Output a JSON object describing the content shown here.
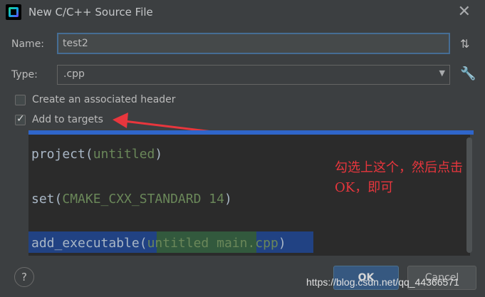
{
  "window": {
    "title": "New C/C++ Source File"
  },
  "form": {
    "name_label": "Name:",
    "name_value": "test2",
    "type_label": "Type:",
    "type_value": ".cpp",
    "checkbox_header_label": "Create an associated header",
    "checkbox_header_checked": false,
    "checkbox_targets_label": "Add to targets",
    "checkbox_targets_checked": true
  },
  "code": {
    "line1_fn": "project(",
    "line1_arg": "untitled",
    "line1_end": ")",
    "line2_fn": "set(",
    "line2_arg": "CMAKE_CXX_STANDARD 14",
    "line2_end": ")",
    "line3_fn": "add_executable(",
    "line3_arg1": "untitled",
    "line3_arg2": "main.cpp",
    "line3_end": ")"
  },
  "annotation": {
    "text": "勾选上这个，然后点击OK，即可"
  },
  "buttons": {
    "help": "?",
    "ok": "OK",
    "cancel": "Cancel"
  },
  "watermark": "https://blog.csdn.net/qq_44366571",
  "colors": {
    "background": "#3c3f41",
    "accent": "#365880",
    "annotation": "#e8363d"
  }
}
